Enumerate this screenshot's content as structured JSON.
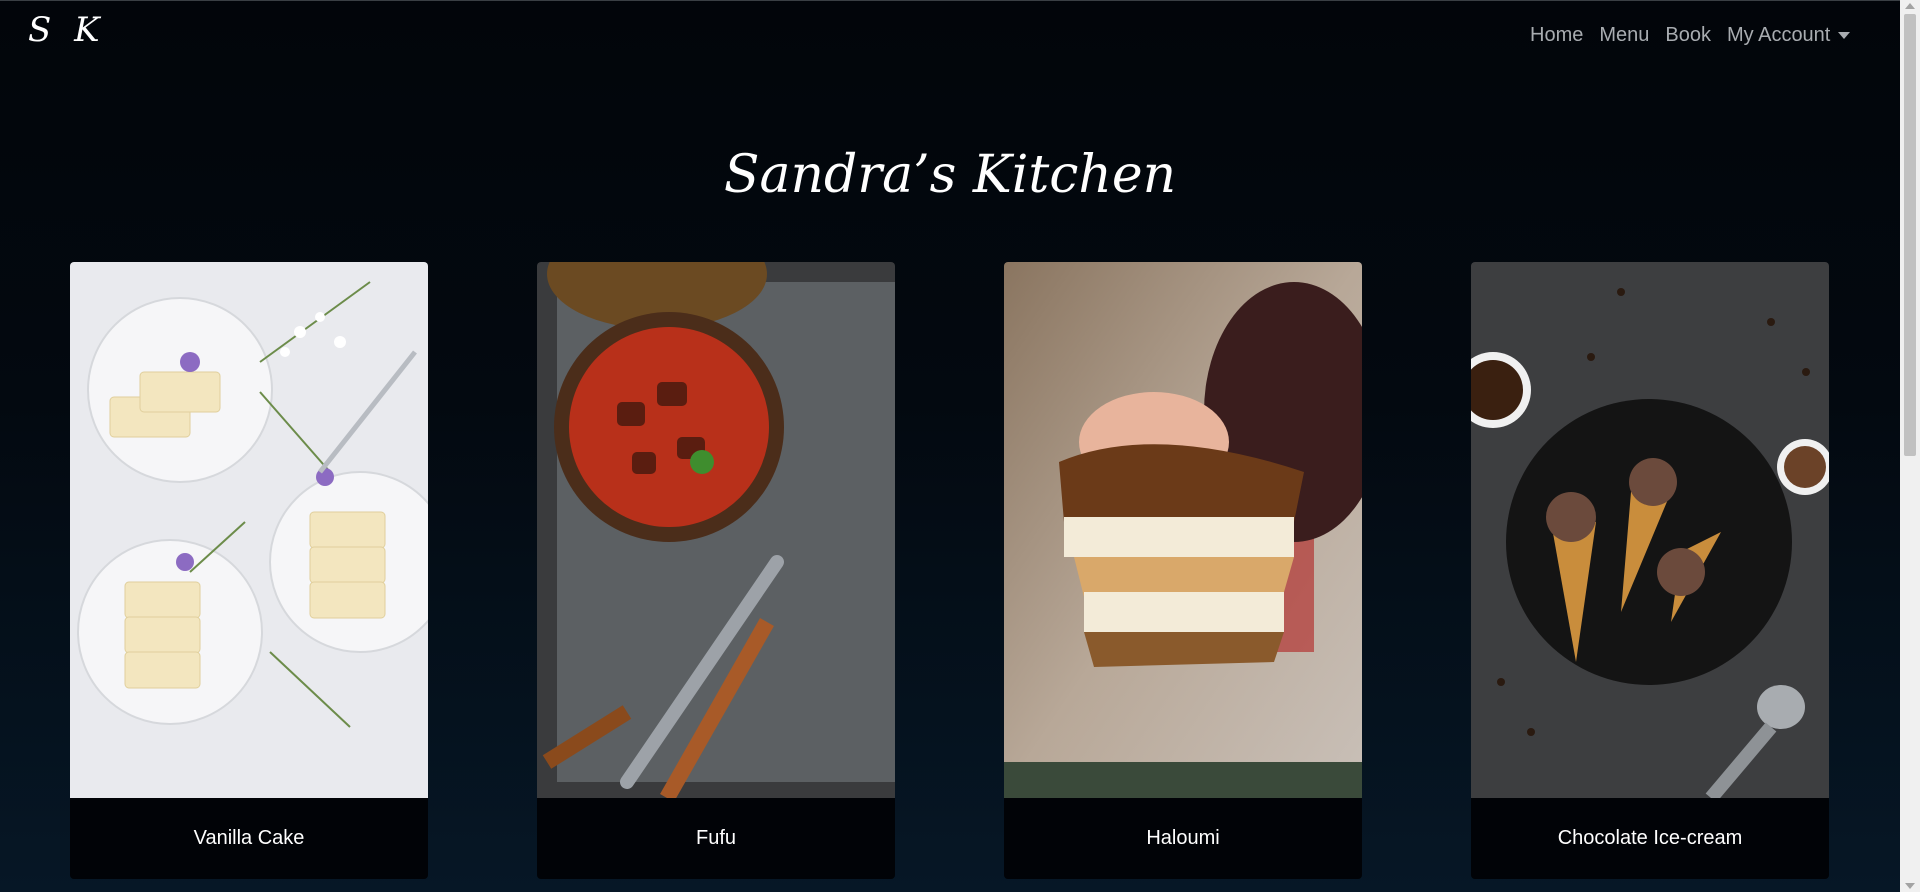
{
  "logo": "S K",
  "nav": {
    "home": "Home",
    "menu": "Menu",
    "book": "Book",
    "account": "My Account"
  },
  "page_title": "Sandra’s Kitchen",
  "cards": [
    {
      "label": "Vanilla Cake"
    },
    {
      "label": "Fufu"
    },
    {
      "label": "Haloumi"
    },
    {
      "label": "Chocolate Ice-cream"
    }
  ]
}
